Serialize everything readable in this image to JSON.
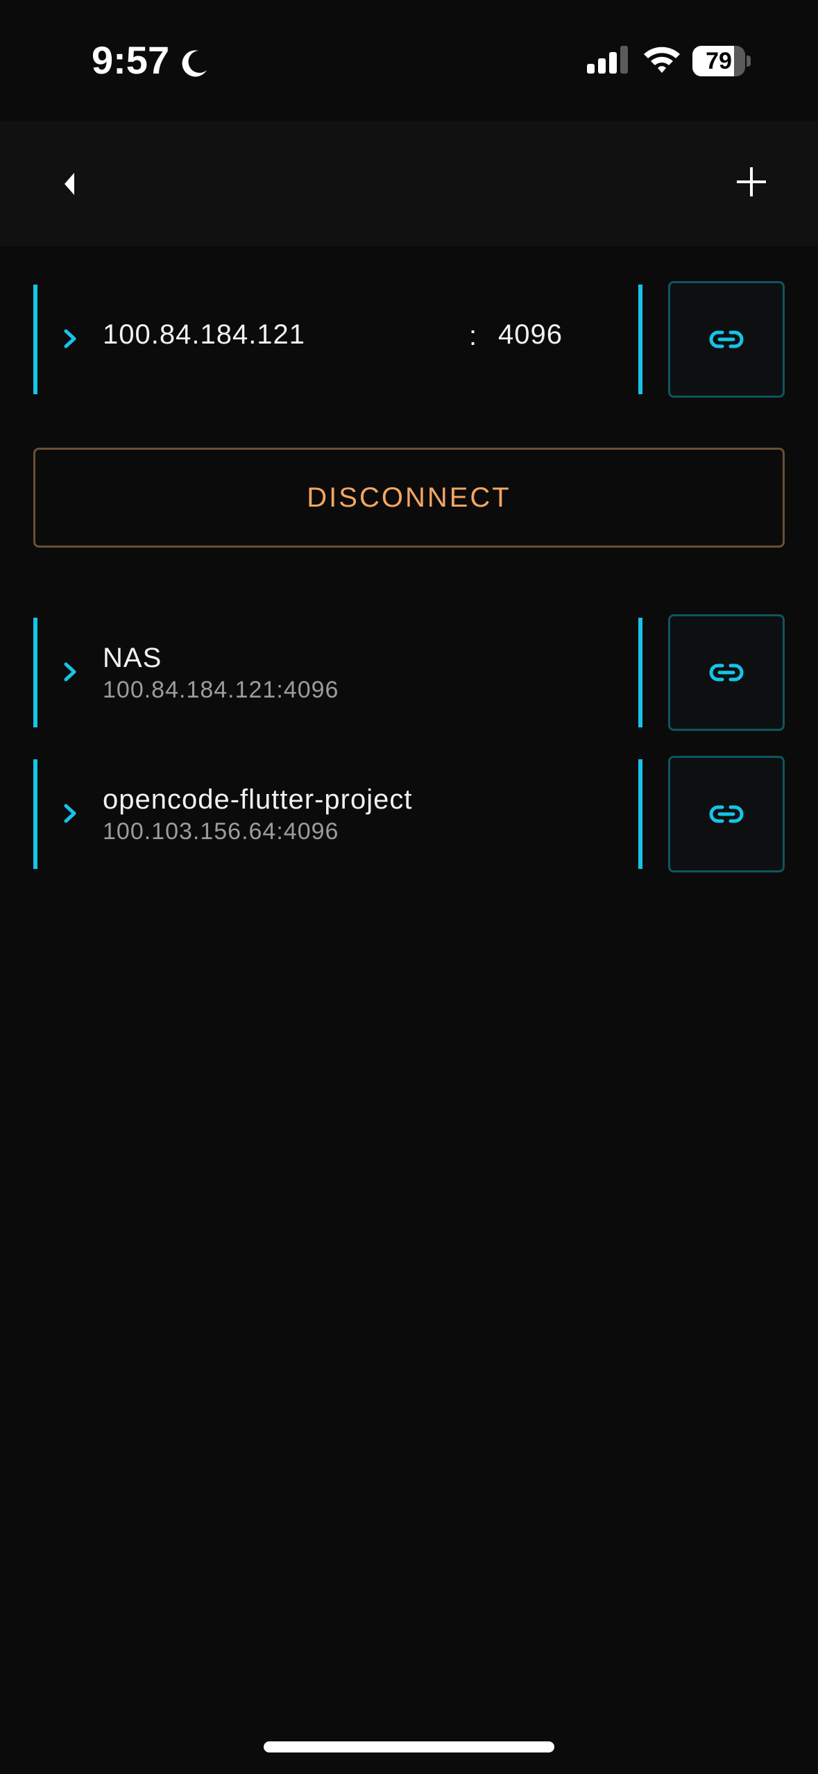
{
  "status_bar": {
    "time": "9:57",
    "battery_level": "79",
    "battery_fraction": 0.79
  },
  "app_bar": {
    "back_icon": "back-arrow-icon",
    "add_icon": "plus-icon"
  },
  "connection": {
    "host": "100.84.184.121",
    "separator": ":",
    "port": "4096",
    "link_icon": "link-icon"
  },
  "disconnect_label": "DISCONNECT",
  "servers": [
    {
      "name": "NAS",
      "address": "100.84.184.121:4096"
    },
    {
      "name": "opencode-flutter-project",
      "address": "100.103.156.64:4096"
    }
  ],
  "colors": {
    "accent": "#16c4e8",
    "disconnect": "#f4a661",
    "background": "#0b0b0b"
  }
}
